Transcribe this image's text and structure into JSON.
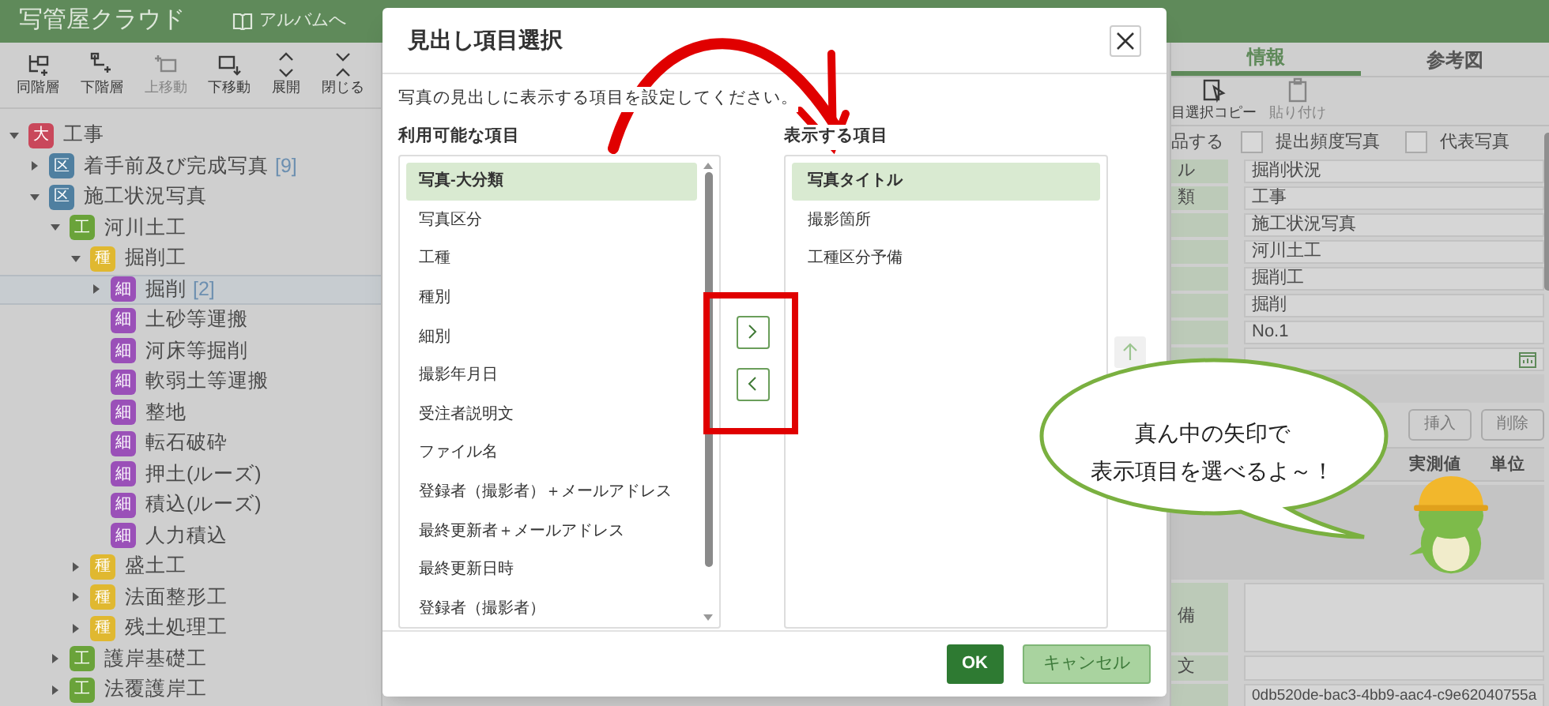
{
  "header": {
    "logo": "写管屋クラウド",
    "album_link": "アルバムへ"
  },
  "tree_toolbar": [
    {
      "label": "同階層",
      "disabled": false
    },
    {
      "label": "下階層",
      "disabled": false
    },
    {
      "label": "上移動",
      "disabled": true
    },
    {
      "label": "下移動",
      "disabled": false
    },
    {
      "label": "展開",
      "disabled": false
    },
    {
      "label": "閉じる",
      "disabled": false
    }
  ],
  "tree": [
    {
      "badge": "大",
      "color": "#c9485b",
      "label": "工事",
      "kind": "branch",
      "expanded": true,
      "selected": false,
      "children": [
        {
          "badge": "区",
          "color": "#4f7fa0",
          "label": "着手前及び完成写真",
          "count": "[9]",
          "kind": "branch",
          "expanded": false,
          "selected": false
        },
        {
          "badge": "区",
          "color": "#4f7fa0",
          "label": "施工状況写真",
          "kind": "branch",
          "expanded": true,
          "selected": false,
          "children": [
            {
              "badge": "工",
              "color": "#6aa33a",
              "label": "河川土工",
              "kind": "branch",
              "expanded": true,
              "selected": false,
              "children": [
                {
                  "badge": "種",
                  "color": "#e0b830",
                  "label": "掘削工",
                  "kind": "branch",
                  "expanded": true,
                  "selected": false,
                  "children": [
                    {
                      "badge": "細",
                      "color": "#9a50b8",
                      "label": "掘削",
                      "count": "[2]",
                      "kind": "branch",
                      "expanded": false,
                      "selected": true
                    },
                    {
                      "badge": "細",
                      "color": "#9a50b8",
                      "label": "土砂等運搬",
                      "kind": "leaf",
                      "selected": false
                    },
                    {
                      "badge": "細",
                      "color": "#9a50b8",
                      "label": "河床等掘削",
                      "kind": "leaf",
                      "selected": false
                    },
                    {
                      "badge": "細",
                      "color": "#9a50b8",
                      "label": "軟弱土等運搬",
                      "kind": "leaf",
                      "selected": false
                    },
                    {
                      "badge": "細",
                      "color": "#9a50b8",
                      "label": "整地",
                      "kind": "leaf",
                      "selected": false
                    },
                    {
                      "badge": "細",
                      "color": "#9a50b8",
                      "label": "転石破砕",
                      "kind": "leaf",
                      "selected": false
                    },
                    {
                      "badge": "細",
                      "color": "#9a50b8",
                      "label": "押土(ルーズ)",
                      "kind": "leaf",
                      "selected": false
                    },
                    {
                      "badge": "細",
                      "color": "#9a50b8",
                      "label": "積込(ルーズ)",
                      "kind": "leaf",
                      "selected": false
                    },
                    {
                      "badge": "細",
                      "color": "#9a50b8",
                      "label": "人力積込",
                      "kind": "leaf",
                      "selected": false
                    }
                  ]
                },
                {
                  "badge": "種",
                  "color": "#e0b830",
                  "label": "盛土工",
                  "kind": "branch",
                  "expanded": false,
                  "selected": false
                },
                {
                  "badge": "種",
                  "color": "#e0b830",
                  "label": "法面整形工",
                  "kind": "branch",
                  "expanded": false,
                  "selected": false
                },
                {
                  "badge": "種",
                  "color": "#e0b830",
                  "label": "残土処理工",
                  "kind": "branch",
                  "expanded": false,
                  "selected": false
                }
              ]
            },
            {
              "badge": "工",
              "color": "#6aa33a",
              "label": "護岸基礎工",
              "kind": "branch",
              "expanded": false,
              "selected": false
            },
            {
              "badge": "工",
              "color": "#6aa33a",
              "label": "法覆護岸工",
              "kind": "branch",
              "expanded": false,
              "selected": false
            }
          ]
        }
      ]
    }
  ],
  "detail": {
    "tabs": [
      {
        "label": "情報",
        "selected": true
      },
      {
        "label": "参考図",
        "selected": false
      }
    ],
    "toolbar": [
      {
        "label": "目選択コピー",
        "disabled": false
      },
      {
        "label": "貼り付け",
        "disabled": true
      }
    ],
    "checkbox_row": {
      "label": "品する",
      "checks": [
        {
          "label": "提出頻度写真",
          "checked": false
        },
        {
          "label": "代表写真",
          "checked": false
        }
      ]
    },
    "fields": [
      {
        "label": "ル",
        "value": "掘削状況"
      },
      {
        "label": "類",
        "value": "工事"
      },
      {
        "value": "施工状況写真"
      },
      {
        "value": "河川土工"
      },
      {
        "value": "掘削工"
      },
      {
        "value": "掘削"
      },
      {
        "value": "No.1"
      },
      {
        "kind": "date"
      }
    ],
    "buttons": [
      {
        "label": "挿入",
        "disabled": true
      },
      {
        "label": "削除",
        "disabled": true
      }
    ],
    "table_columns": [
      "実測値",
      "単位"
    ],
    "lower_fields": [
      {
        "label": "備",
        "kind": "textarea"
      },
      {
        "label": "文",
        "kind": "text"
      },
      {
        "value": "0db520de-bac3-4bb9-aac4-c9e62040755a",
        "kind": "text"
      }
    ]
  },
  "dialog": {
    "title": "見出し項目選択",
    "instruction": "写真の見出しに表示する項目を設定してください。",
    "available": {
      "label": "利用可能な項目",
      "items": [
        {
          "label": "写真-大分類",
          "selected": true
        },
        {
          "label": "写真区分",
          "selected": false
        },
        {
          "label": "工種",
          "selected": false
        },
        {
          "label": "種別",
          "selected": false
        },
        {
          "label": "細別",
          "selected": false
        },
        {
          "label": "撮影年月日",
          "selected": false
        },
        {
          "label": "受注者説明文",
          "selected": false
        },
        {
          "label": "ファイル名",
          "selected": false
        },
        {
          "label": "登録者（撮影者）＋メールアドレス",
          "selected": false
        },
        {
          "label": "最終更新者＋メールアドレス",
          "selected": false
        },
        {
          "label": "最終更新日時",
          "selected": false
        },
        {
          "label": "登録者（撮影者）",
          "selected": false
        }
      ]
    },
    "displayed": {
      "label": "表示する項目",
      "items": [
        {
          "label": "写真タイトル",
          "selected": true
        },
        {
          "label": "撮影箇所",
          "selected": false
        },
        {
          "label": "工種区分予備",
          "selected": false
        }
      ]
    },
    "buttons": [
      {
        "label": "OK",
        "kind": "primary"
      },
      {
        "label": "キャンセル",
        "kind": "secondary"
      }
    ]
  },
  "callout": {
    "lines": [
      "真ん中の矢印で",
      "表示項目を選べるよ～！"
    ]
  }
}
